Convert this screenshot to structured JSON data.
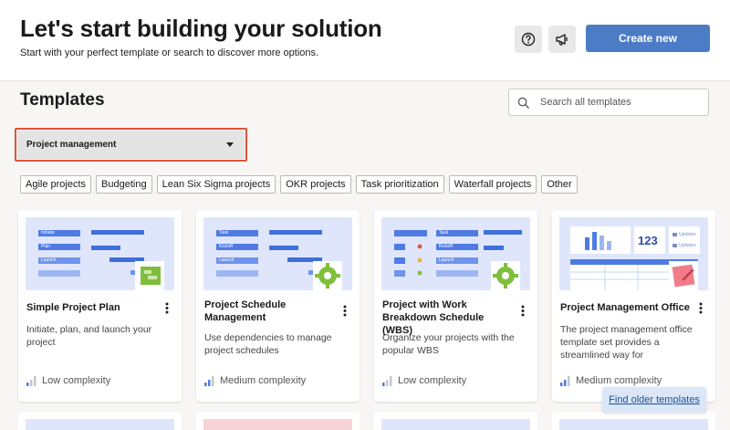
{
  "header": {
    "title": "Let's start building your solution",
    "subtitle": "Start with your perfect template or search to discover more options.",
    "help_icon": "question-circle-icon",
    "announce_icon": "megaphone-icon",
    "create_label": "Create new"
  },
  "templates": {
    "title": "Templates",
    "search_placeholder": "Search all templates",
    "category_selected": "Project management",
    "chips": [
      "Agile projects",
      "Budgeting",
      "Lean Six Sigma projects",
      "OKR projects",
      "Task prioritization",
      "Waterfall projects",
      "Other"
    ],
    "cards": [
      {
        "title": "Simple Project Plan",
        "description": "Initiate, plan, and launch your project",
        "complexity": "Low complexity",
        "complexity_level": 1,
        "thumb_labels": [
          "Initiate",
          "Plan",
          "Launch"
        ]
      },
      {
        "title": "Project Schedule Management",
        "description": "Use dependencies to manage project schedules",
        "complexity": "Medium complexity",
        "complexity_level": 2,
        "thumb_labels": [
          "Task",
          "Kickoff",
          "Launch"
        ]
      },
      {
        "title": "Project with Work Breakdown Schedule (WBS)",
        "description": "Organize your projects with the popular WBS",
        "complexity": "Low complexity",
        "complexity_level": 1,
        "thumb_labels": [
          "Task",
          "Kickoff",
          "Launch"
        ]
      },
      {
        "title": "Project Management Office",
        "description": "The project management office template set provides a streamlined way for organizations to track an...",
        "complexity": "Medium complexity",
        "complexity_level": 2,
        "thumb_number": "123",
        "thumb_labels": [
          "Updates",
          "Updates"
        ]
      }
    ],
    "find_older": "Find older templates"
  },
  "colors": {
    "accent": "#4c7cc6",
    "highlight": "#e0533b",
    "thumb_bg": "#dfe6fb",
    "bar_blue": "#4f7be3"
  }
}
